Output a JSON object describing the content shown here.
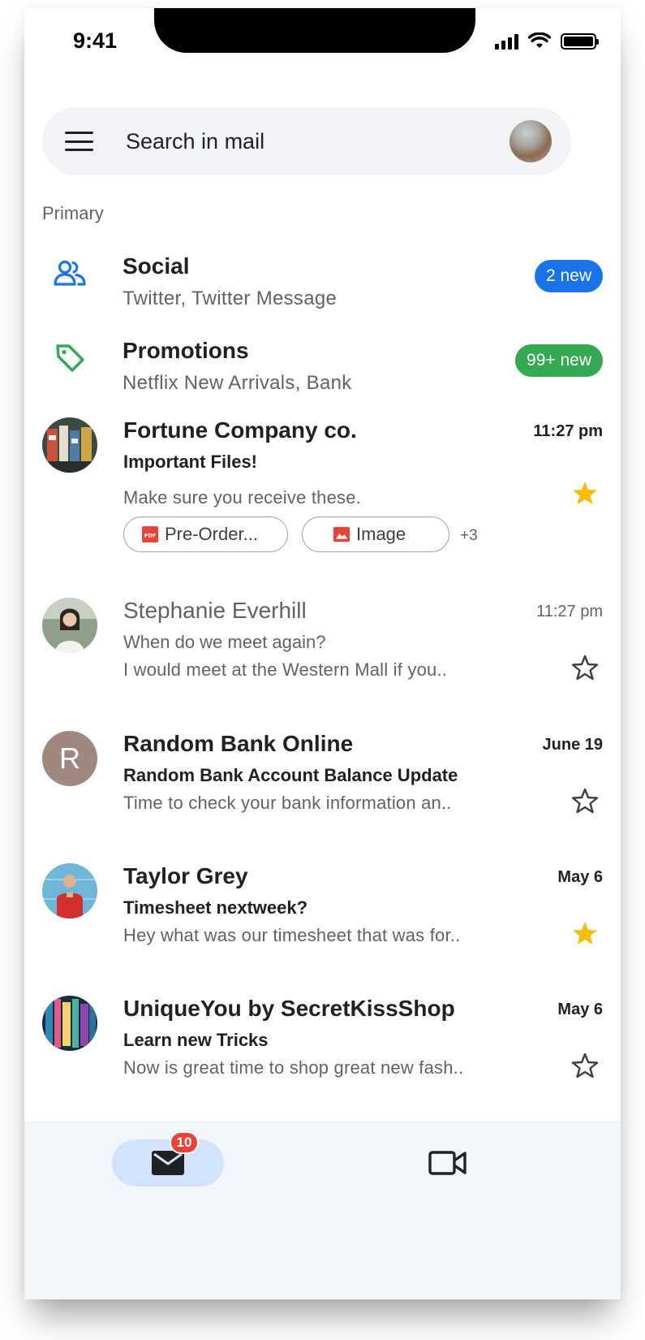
{
  "status_bar": {
    "time": "9:41"
  },
  "search": {
    "placeholder": "Search in mail"
  },
  "section_label": "Primary",
  "categories": [
    {
      "title": "Social",
      "subtitle": "Twitter, Twitter Message",
      "badge": "2 new",
      "color": "#1a73e8",
      "icon": "people-icon"
    },
    {
      "title": "Promotions",
      "subtitle": "Netflix New Arrivals, Bank",
      "badge": "99+ new",
      "color": "#34a853",
      "icon": "tag-icon"
    }
  ],
  "emails": [
    {
      "sender": "Fortune Company co.",
      "time": "11:27 pm",
      "subject": "Important Files!",
      "snippet": "Make sure you receive these.",
      "starred": true,
      "unread": true,
      "attachments": [
        {
          "name": "Pre-Order...",
          "type": "pdf-icon",
          "pdf_label": "PDF"
        },
        {
          "name": "Image",
          "type": "image-icon"
        }
      ],
      "more_attachments": "+3"
    },
    {
      "sender": "Stephanie Everhill",
      "time": "11:27 pm",
      "subject": "When do we meet again?",
      "snippet": "I would meet at the Western Mall if you..",
      "starred": false,
      "unread": false
    },
    {
      "sender": "Random Bank Online",
      "time": "June 19",
      "subject": "Random Bank Account Balance Update",
      "snippet": "Time to check your bank information an..",
      "starred": false,
      "unread": true,
      "avatar_letter": "R"
    },
    {
      "sender": "Taylor Grey",
      "time": "May 6",
      "subject": "Timesheet nextweek?",
      "snippet": "Hey what was our timesheet that was for..",
      "starred": true,
      "unread": true
    },
    {
      "sender": "UniqueYou by SecretKissShop",
      "time": "May 6",
      "subject": "Learn new Tricks",
      "snippet": "Now is great time to shop great new fash..",
      "starred": false,
      "unread": true
    }
  ],
  "bottom_nav": {
    "mail_badge": "10"
  },
  "colors": {
    "star": "#fbbc04",
    "accent_blue": "#1a73e8",
    "green": "#34a853",
    "badge_red": "#ea4335"
  }
}
